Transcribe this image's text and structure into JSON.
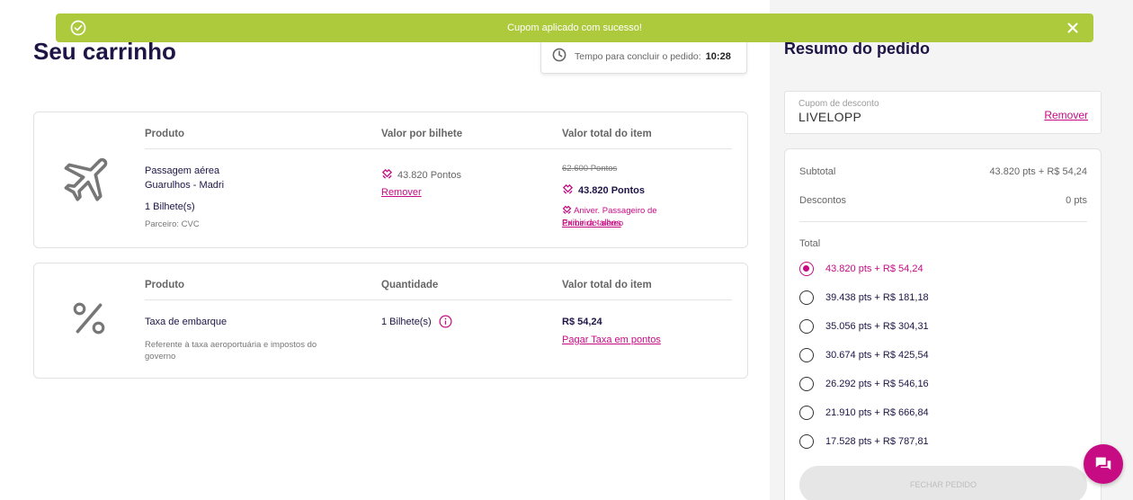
{
  "toast": {
    "message": "Cupom aplicado com sucesso!"
  },
  "cart": {
    "title": "Seu carrinho",
    "timer": {
      "label": "Tempo para concluir o pedido:",
      "value": "10:28"
    },
    "item1": {
      "col_product": "Produto",
      "col_unit": "Valor por bilhete",
      "col_total": "Valor total do item",
      "product_name": "Passagem aérea",
      "route": "Guarulhos - Madri",
      "tickets": "1 Bilhete(s)",
      "partner": "Parceiro: CVC",
      "unit_points": "43.820 Pontos",
      "remove": "Remover",
      "old_points": "62.600 Pontos",
      "total_points": "43.820 Pontos",
      "promo": "Aniver. Passageiro de Primeira - aéreo",
      "details": "Exibir detalhes"
    },
    "item2": {
      "col_product": "Produto",
      "col_qty": "Quantidade",
      "col_total": "Valor total do item",
      "product_name": "Taxa de embarque",
      "description": "Referente à taxa aeroportuária e impostos do governo",
      "qty": "1 Bilhete(s)",
      "total": "R$ 54,24",
      "pay_points": "Pagar Taxa em pontos"
    }
  },
  "summary": {
    "title": "Resumo do pedido",
    "coupon": {
      "label": "Cupom de desconto",
      "value": "LIVELOPP",
      "remove": "Remover"
    },
    "subtotal_label": "Subtotal",
    "subtotal_value": "43.820 pts + R$ 54,24",
    "discounts_label": "Descontos",
    "discounts_value": "0 pts",
    "total_label": "Total",
    "options": [
      "43.820 pts + R$ 54,24",
      "39.438 pts + R$ 181,18",
      "35.056 pts + R$ 304,31",
      "30.674 pts + R$ 425,54",
      "26.292 pts + R$ 546,16",
      "21.910 pts + R$ 666,84",
      "17.528 pts + R$ 787,81"
    ],
    "selected_option": 0,
    "close_button": "FECHAR PEDIDO"
  },
  "colors": {
    "accent": "#c60b83",
    "navy": "#1e1446",
    "toast": "#adca3d"
  },
  "icons": [
    "check-circle-icon",
    "close-icon",
    "clock-icon",
    "airplane-icon",
    "percent-icon",
    "points-icon",
    "info-icon",
    "chat-icon"
  ]
}
